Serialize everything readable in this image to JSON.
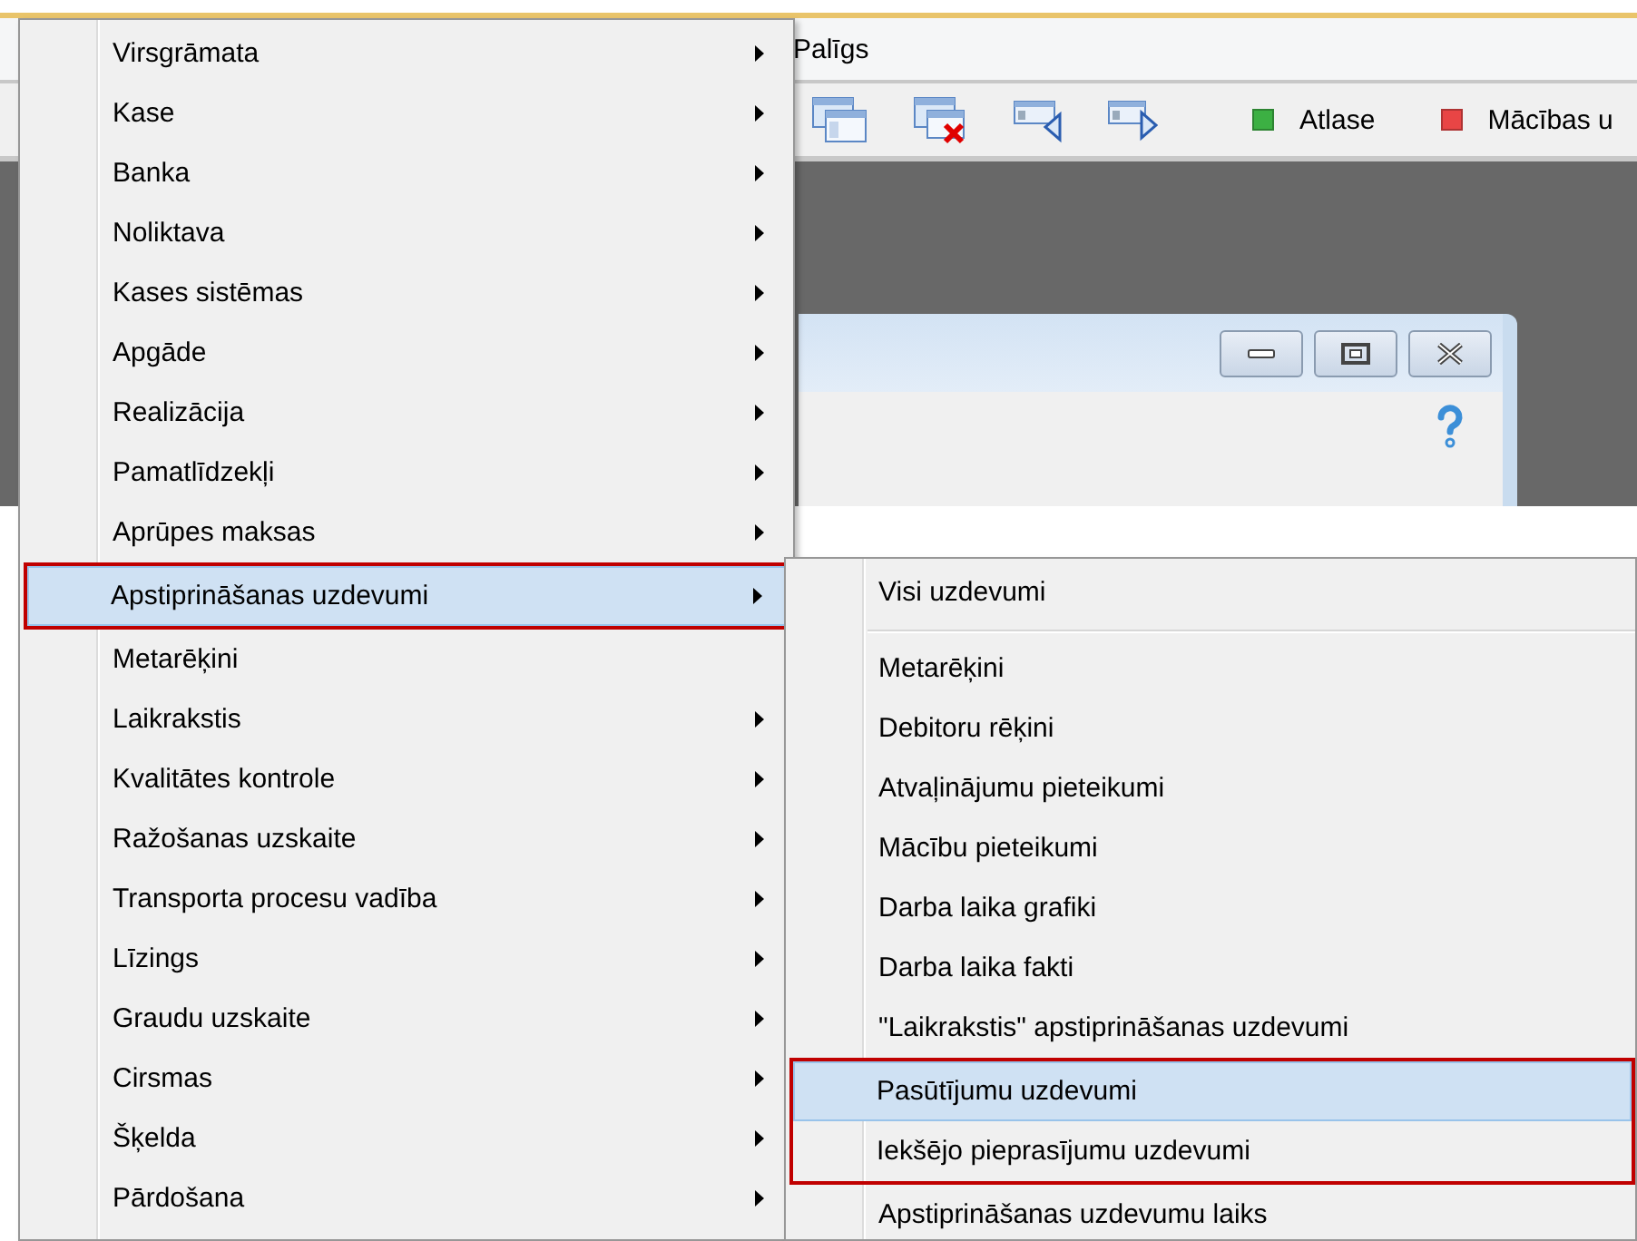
{
  "menubar": {
    "items": [
      "Palīgs"
    ]
  },
  "toolbar": {
    "icon_buttons": [
      {
        "kind": "window"
      },
      {
        "kind": "window-delete"
      },
      {
        "kind": "window-left"
      },
      {
        "kind": "window-right"
      }
    ],
    "filters": [
      {
        "label": "Atlase",
        "color": "#3cb043"
      },
      {
        "label": "Mācības u",
        "color": "#e84545"
      }
    ]
  },
  "child_window": {
    "buttons": [
      {
        "kind": "minimize"
      },
      {
        "kind": "maximize"
      },
      {
        "kind": "close"
      }
    ]
  },
  "main_menu": {
    "items": [
      {
        "kind": "item",
        "label": "Virsgrāmata",
        "submenu": true,
        "selected": false,
        "emphasized": false
      },
      {
        "kind": "item",
        "label": "Kase",
        "submenu": true,
        "selected": false,
        "emphasized": false
      },
      {
        "kind": "item",
        "label": "Banka",
        "submenu": true,
        "selected": false,
        "emphasized": false
      },
      {
        "kind": "item",
        "label": "Noliktava",
        "submenu": true,
        "selected": false,
        "emphasized": false
      },
      {
        "kind": "item",
        "label": "Kases sistēmas",
        "submenu": true,
        "selected": false,
        "emphasized": false
      },
      {
        "kind": "item",
        "label": "Apgāde",
        "submenu": true,
        "selected": false,
        "emphasized": false
      },
      {
        "kind": "item",
        "label": "Realizācija",
        "submenu": true,
        "selected": false,
        "emphasized": false
      },
      {
        "kind": "item",
        "label": "Pamatlīdzekļi",
        "submenu": true,
        "selected": false,
        "emphasized": false
      },
      {
        "kind": "item",
        "label": "Aprūpes maksas",
        "submenu": true,
        "selected": false,
        "emphasized": false
      },
      {
        "kind": "item",
        "label": "Apstiprināšanas uzdevumi",
        "submenu": true,
        "selected": true,
        "emphasized": true
      },
      {
        "kind": "item",
        "label": "Metarēķini",
        "submenu": false,
        "selected": false,
        "emphasized": false
      },
      {
        "kind": "item",
        "label": "Laikrakstis",
        "submenu": true,
        "selected": false,
        "emphasized": false
      },
      {
        "kind": "item",
        "label": "Kvalitātes kontrole",
        "submenu": true,
        "selected": false,
        "emphasized": false
      },
      {
        "kind": "item",
        "label": "Ražošanas uzskaite",
        "submenu": true,
        "selected": false,
        "emphasized": false
      },
      {
        "kind": "item",
        "label": "Transporta procesu vadība",
        "submenu": true,
        "selected": false,
        "emphasized": false
      },
      {
        "kind": "item",
        "label": "Līzings",
        "submenu": true,
        "selected": false,
        "emphasized": false
      },
      {
        "kind": "item",
        "label": "Graudu uzskaite",
        "submenu": true,
        "selected": false,
        "emphasized": false
      },
      {
        "kind": "item",
        "label": "Cirsmas",
        "submenu": true,
        "selected": false,
        "emphasized": false
      },
      {
        "kind": "item",
        "label": "Šķelda",
        "submenu": true,
        "selected": false,
        "emphasized": false
      },
      {
        "kind": "item",
        "label": "Pārdošana",
        "submenu": true,
        "selected": false,
        "emphasized": false
      }
    ]
  },
  "submenu": {
    "items": [
      {
        "kind": "item",
        "label": "Visi uzdevumi",
        "submenu": false,
        "selected": false,
        "emphasized": false
      },
      {
        "kind": "separator"
      },
      {
        "kind": "item",
        "label": "Metarēķini",
        "submenu": false,
        "selected": false,
        "emphasized": false
      },
      {
        "kind": "item",
        "label": "Debitoru rēķini",
        "submenu": false,
        "selected": false,
        "emphasized": false
      },
      {
        "kind": "item",
        "label": "Atvaļinājumu pieteikumi",
        "submenu": false,
        "selected": false,
        "emphasized": false
      },
      {
        "kind": "item",
        "label": "Mācību pieteikumi",
        "submenu": false,
        "selected": false,
        "emphasized": false
      },
      {
        "kind": "item",
        "label": "Darba laika grafiki",
        "submenu": false,
        "selected": false,
        "emphasized": false
      },
      {
        "kind": "item",
        "label": "Darba laika fakti",
        "submenu": false,
        "selected": false,
        "emphasized": false
      },
      {
        "kind": "item",
        "label": "\"Laikrakstis\" apstiprināšanas uzdevumi",
        "submenu": false,
        "selected": false,
        "emphasized": false
      },
      {
        "kind": "item",
        "label": "Pasūtījumu uzdevumi",
        "submenu": false,
        "selected": true,
        "emphasized": true
      },
      {
        "kind": "item",
        "label": "Iekšējo pieprasījumu uzdevumi",
        "submenu": false,
        "selected": false,
        "emphasized": true
      },
      {
        "kind": "item",
        "label": "Apstiprināšanas uzdevumu laiks",
        "submenu": false,
        "selected": false,
        "emphasized": false
      }
    ]
  }
}
